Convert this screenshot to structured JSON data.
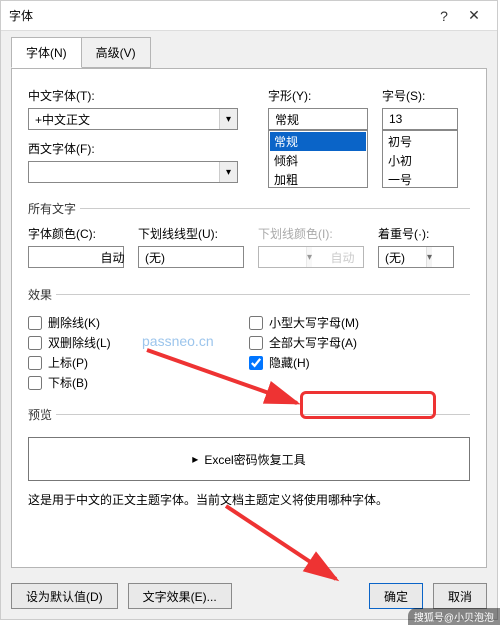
{
  "title": "字体",
  "tabs": {
    "font": "字体(N)",
    "advanced": "高级(V)"
  },
  "labels": {
    "cn_font": "中文字体(T):",
    "west_font": "西文字体(F):",
    "style": "字形(Y):",
    "size": "字号(S):",
    "all_text": "所有文字",
    "font_color": "字体颜色(C):",
    "underline_style": "下划线线型(U):",
    "underline_color": "下划线颜色(I):",
    "emphasis": "着重号(·):",
    "effects": "效果",
    "preview": "预览",
    "desc": "这是用于中文的正文主题字体。当前文档主题定义将使用哪种字体。"
  },
  "values": {
    "cn_font": "+中文正文",
    "west_font": "",
    "style": "常规",
    "size": "13",
    "font_color": "自动",
    "underline_style": "(无)",
    "underline_color": "自动",
    "emphasis": "(无)"
  },
  "style_options": [
    "常规",
    "倾斜",
    "加粗"
  ],
  "size_options": [
    "初号",
    "小初",
    "一号"
  ],
  "checks": {
    "strike": "删除线(K)",
    "dstrike": "双删除线(L)",
    "sup": "上标(P)",
    "sub": "下标(B)",
    "smallcaps": "小型大写字母(M)",
    "allcaps": "全部大写字母(A)",
    "hidden": "隐藏(H)"
  },
  "preview_text": "Excel密码恢复工具",
  "buttons": {
    "default": "设为默认值(D)",
    "text_effects": "文字效果(E)...",
    "ok": "确定",
    "cancel": "取消"
  },
  "watermark": "passneo.cn",
  "attribution": "搜狐号@小贝泡泡"
}
